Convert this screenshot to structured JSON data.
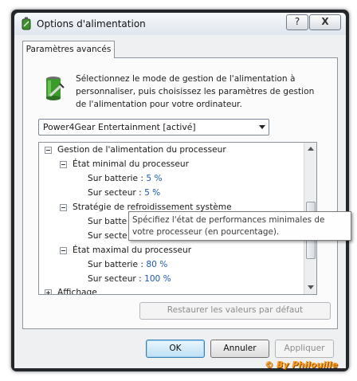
{
  "window": {
    "title": "Options d'alimentation",
    "help_label": "?",
    "close_label": "X"
  },
  "tab": {
    "label": "Paramètres avancés"
  },
  "intro": {
    "text": "Sélectionnez le mode de gestion de l'alimentation à personnaliser, puis choisissez les paramètres de gestion de l'alimentation pour votre ordinateur."
  },
  "plan_select": {
    "value": "Power4Gear Entertainment [activé]"
  },
  "tree": {
    "rows": [
      {
        "text": "Gestion de l'alimentation du processeur"
      },
      {
        "text": "État minimal du processeur"
      },
      {
        "label": "Sur batterie :",
        "value": "5 %"
      },
      {
        "label": "Sur secteur :",
        "value": "5 %"
      },
      {
        "text": "Stratégie de refroidissement système"
      },
      {
        "label": "Sur batte"
      },
      {
        "label": "Sur secte"
      },
      {
        "text": "État maximal du processeur"
      },
      {
        "label": "Sur batterie :",
        "value": "80 %"
      },
      {
        "label": "Sur secteur :",
        "value": "100 %"
      },
      {
        "text": "Affichage"
      }
    ]
  },
  "tooltip": {
    "text": "Spécifiez l'état de performances minimales de votre processeur (en pourcentage)."
  },
  "buttons": {
    "restore": "Restaurer les valeurs par défaut",
    "ok": "OK",
    "cancel": "Annuler",
    "apply": "Appliquer"
  },
  "watermark": "© By Philouille"
}
